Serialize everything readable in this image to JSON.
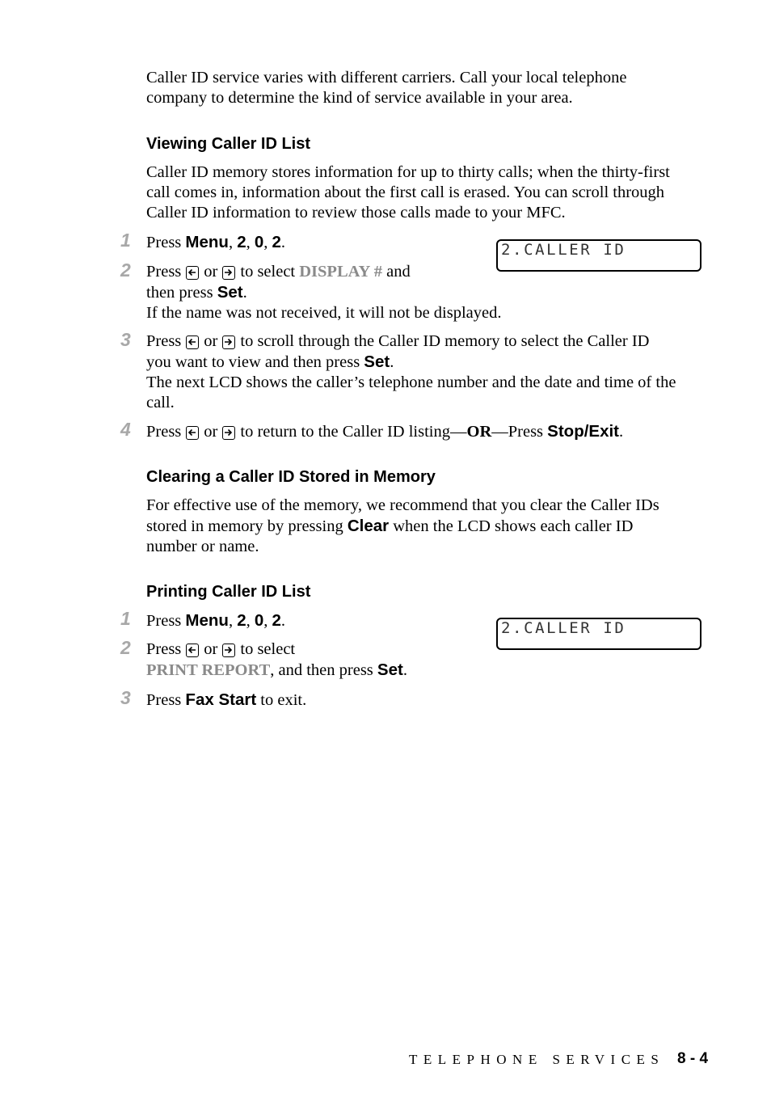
{
  "intro": {
    "line1": "Caller ID service varies with different carriers.  Call your local telephone",
    "line2": "company to determine the kind of service available in your area."
  },
  "viewing": {
    "heading": "Viewing Caller ID List",
    "para": [
      "Caller ID memory stores information for up to thirty calls; when the thirty-first",
      "call comes in, information about the first call is erased.  You can scroll through",
      "Caller ID information to review those calls made to your MFC."
    ],
    "lcd": "2.CALLER ID",
    "steps": [
      {
        "num": "1",
        "press": "Press ",
        "menu": "Menu",
        "k2": "2",
        "k0": "0",
        "k2b": "2",
        "sep": ", ",
        "end": "."
      },
      {
        "num": "2",
        "press": "Press",
        "or": "or",
        "to_select": "to select ",
        "option": "DISPLAY #",
        "and": " and",
        "then_press": "then press ",
        "set": "Set",
        "dot": ".",
        "note": "If the name was not received, it will not be displayed."
      },
      {
        "num": "3",
        "press": "Press",
        "or": "or",
        "rest1": "to scroll through the Caller ID memory to select the Caller ID",
        "line2a": "you want to view and then press ",
        "set": "Set",
        "dot": ".",
        "line3": "The next LCD shows the caller’s telephone number and the date and time of the",
        "line4": "call."
      },
      {
        "num": "4",
        "press": "Press",
        "or": "or",
        "rest": "to return to the Caller ID listing—",
        "or_caps": "OR",
        "press2": "—Press ",
        "stop": "Stop/Exit",
        "dot": "."
      }
    ]
  },
  "clearing": {
    "heading": "Clearing a Caller ID Stored in Memory",
    "line1": "For effective use of the memory, we recommend that you clear the Caller IDs",
    "line2a": "stored in memory by pressing ",
    "clear": "Clear",
    "line2b": " when the LCD shows each caller ID",
    "line3": "number or name."
  },
  "printing": {
    "heading": "Printing Caller ID List",
    "lcd": "2.CALLER ID",
    "steps": [
      {
        "num": "1",
        "press": "Press ",
        "menu": "Menu",
        "k2": "2",
        "k0": "0",
        "k2b": "2",
        "sep": ", ",
        "end": "."
      },
      {
        "num": "2",
        "press": "Press",
        "or": "or",
        "to_select": "to select",
        "option": "PRINT REPORT",
        "then": ", and then press ",
        "set": "Set",
        "dot": "."
      },
      {
        "num": "3",
        "press": "Press ",
        "fax": "Fax Start",
        "rest": " to exit."
      }
    ]
  },
  "icons": {
    "left": "left-arrow-key-icon",
    "right": "right-arrow-key-icon"
  },
  "footer": {
    "section": "TELEPHONE SERVICES",
    "page": "8 - 4"
  }
}
